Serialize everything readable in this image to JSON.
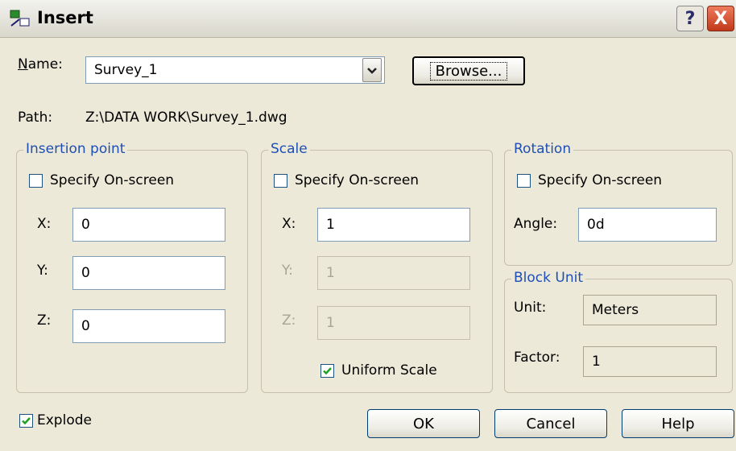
{
  "title": "Insert",
  "window_buttons": {
    "help": "?",
    "close": "X"
  },
  "name_label": "Name:",
  "name_value": "Survey_1",
  "browse": "Browse...",
  "path_label": "Path:",
  "path_value": "Z:\\DATA WORK\\Survey_1.dwg",
  "insertion": {
    "title": "Insertion point",
    "specify": "Specify On-screen",
    "specify_checked": false,
    "x_label": "X:",
    "x": "0",
    "y_label": "Y:",
    "y": "0",
    "z_label": "Z:",
    "z": "0"
  },
  "scale": {
    "title": "Scale",
    "specify": "Specify On-screen",
    "specify_checked": false,
    "x_label": "X:",
    "x": "1",
    "y_label": "Y:",
    "y": "1",
    "z_label": "Z:",
    "z": "1",
    "uniform": "Uniform Scale",
    "uniform_checked": true
  },
  "rotation": {
    "title": "Rotation",
    "specify": "Specify On-screen",
    "specify_checked": false,
    "angle_label": "Angle:",
    "angle": "0d"
  },
  "block_unit": {
    "title": "Block Unit",
    "unit_label": "Unit:",
    "unit": "Meters",
    "factor_label": "Factor:",
    "factor": "1"
  },
  "explode": "Explode",
  "explode_checked": true,
  "buttons": {
    "ok": "OK",
    "cancel": "Cancel",
    "help": "Help"
  },
  "colors": {
    "group_title": "#1f4fb4",
    "dialog_bg": "#ece9d8",
    "check": "#21a121"
  }
}
